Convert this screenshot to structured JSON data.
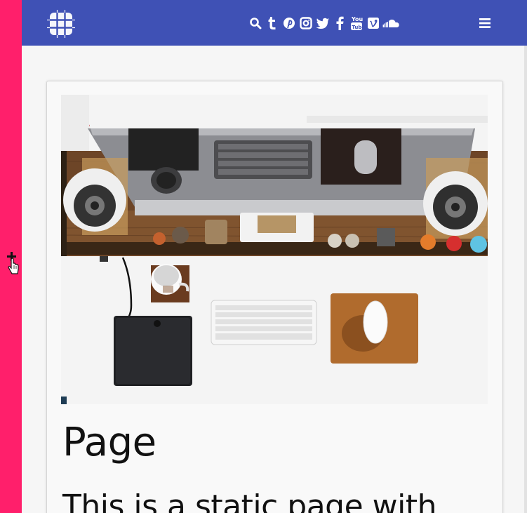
{
  "theme": {
    "sidebar_color": "#ff1f6b",
    "header_color": "#3f51b5",
    "background": "#f6f6f6"
  },
  "header": {
    "logo_icon": "grid-logo-icon",
    "social_icons": [
      "search-icon",
      "tumblr-icon",
      "pinterest-icon",
      "instagram-icon",
      "twitter-icon",
      "facebook-icon",
      "youtube-icon",
      "vimeo-icon",
      "soundcloud-icon"
    ],
    "menu_icon": "hamburger-menu-icon"
  },
  "sidebar": {
    "toggle_icon": "plus-icon",
    "cursor_icon": "hand-pointer-icon"
  },
  "content": {
    "hero_image": "desk-workspace-photo",
    "title": "Page",
    "body": "This is a static page with"
  }
}
